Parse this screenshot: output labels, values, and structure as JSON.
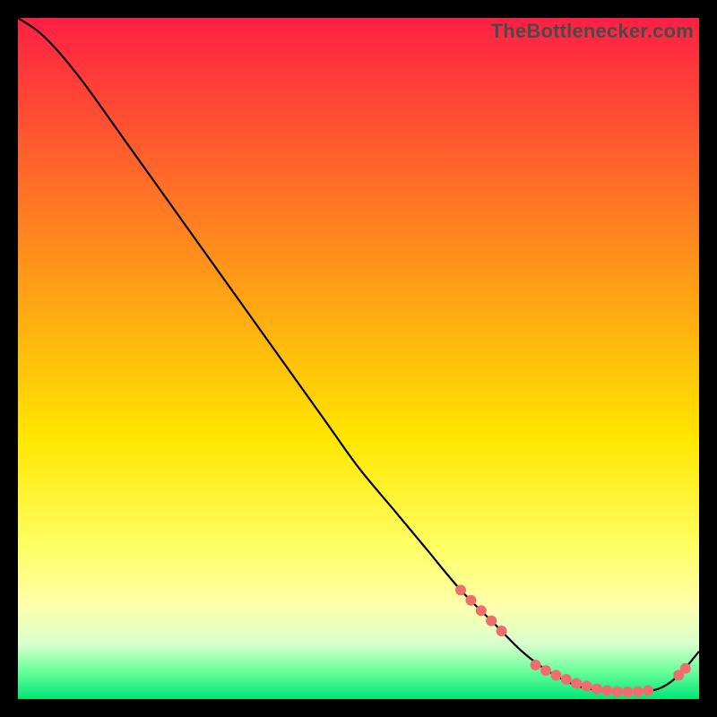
{
  "watermark": "TheBottlenecker.com",
  "chart_data": {
    "type": "line",
    "title": "",
    "xlabel": "",
    "ylabel": "",
    "xlim": [
      0,
      100
    ],
    "ylim": [
      0,
      100
    ],
    "background_gradient": {
      "stops": [
        {
          "pct": 0,
          "color": "#ff1f44"
        },
        {
          "pct": 45,
          "color": "#ffb010"
        },
        {
          "pct": 62,
          "color": "#ffe700"
        },
        {
          "pct": 78,
          "color": "#ffff66"
        },
        {
          "pct": 86,
          "color": "#ffffaa"
        },
        {
          "pct": 92,
          "color": "#d8ffcc"
        },
        {
          "pct": 96,
          "color": "#66ff99"
        },
        {
          "pct": 100,
          "color": "#00e676"
        }
      ]
    },
    "series": [
      {
        "name": "bottleneck-curve",
        "color": "#000000",
        "x": [
          0,
          3,
          6,
          10,
          15,
          20,
          25,
          30,
          35,
          40,
          45,
          50,
          55,
          60,
          65,
          70,
          74,
          78,
          82,
          86,
          90,
          94,
          97,
          100
        ],
        "y": [
          100,
          98,
          95,
          90,
          83,
          76,
          69,
          62,
          55,
          48,
          41,
          34,
          28,
          22,
          16,
          11,
          7,
          4,
          2,
          1.2,
          1,
          1.5,
          3.5,
          7
        ]
      }
    ],
    "markers": {
      "name": "highlight-region",
      "color": "#ef6d6d",
      "radius_px": 6,
      "points": [
        {
          "x": 65,
          "y": 16
        },
        {
          "x": 66.5,
          "y": 14.5
        },
        {
          "x": 68,
          "y": 13
        },
        {
          "x": 69.5,
          "y": 11.5
        },
        {
          "x": 71,
          "y": 10
        },
        {
          "x": 76,
          "y": 5
        },
        {
          "x": 77.5,
          "y": 4.2
        },
        {
          "x": 79,
          "y": 3.5
        },
        {
          "x": 80.5,
          "y": 2.9
        },
        {
          "x": 82,
          "y": 2.3
        },
        {
          "x": 83.5,
          "y": 1.9
        },
        {
          "x": 85,
          "y": 1.5
        },
        {
          "x": 86.5,
          "y": 1.25
        },
        {
          "x": 88,
          "y": 1.1
        },
        {
          "x": 89.5,
          "y": 1.05
        },
        {
          "x": 91,
          "y": 1.1
        },
        {
          "x": 92.5,
          "y": 1.25
        },
        {
          "x": 97,
          "y": 3.5
        },
        {
          "x": 98,
          "y": 4.5
        }
      ]
    }
  }
}
